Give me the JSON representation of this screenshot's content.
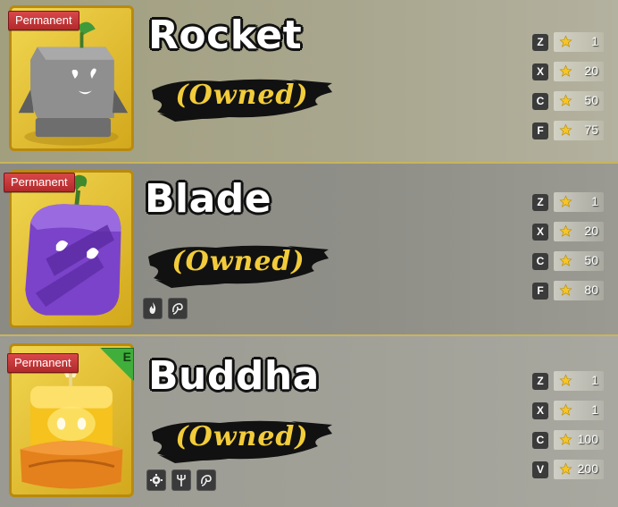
{
  "fruits": [
    {
      "name": "Rocket",
      "badge": "Permanent",
      "status": "(Owned)",
      "color": "#7a7a7a",
      "moves": [
        {
          "key": "Z",
          "level": "1"
        },
        {
          "key": "X",
          "level": "20"
        },
        {
          "key": "C",
          "level": "50"
        },
        {
          "key": "F",
          "level": "75"
        }
      ],
      "type_icons": []
    },
    {
      "name": "Blade",
      "badge": "Permanent",
      "status": "(Owned)",
      "color": "#7b43c9",
      "moves": [
        {
          "key": "Z",
          "level": "1"
        },
        {
          "key": "X",
          "level": "20"
        },
        {
          "key": "C",
          "level": "50"
        },
        {
          "key": "F",
          "level": "80"
        }
      ],
      "type_icons": [
        "flame-icon",
        "swirl-icon"
      ]
    },
    {
      "name": "Buddha",
      "badge": "Permanent",
      "corner_badge": "E",
      "status": "(Owned)",
      "color": "#f0b31e",
      "moves": [
        {
          "key": "Z",
          "level": "1"
        },
        {
          "key": "X",
          "level": "1"
        },
        {
          "key": "C",
          "level": "100"
        },
        {
          "key": "V",
          "level": "200"
        }
      ],
      "type_icons": [
        "gear-icon",
        "trident-icon",
        "swirl-icon"
      ]
    }
  ]
}
